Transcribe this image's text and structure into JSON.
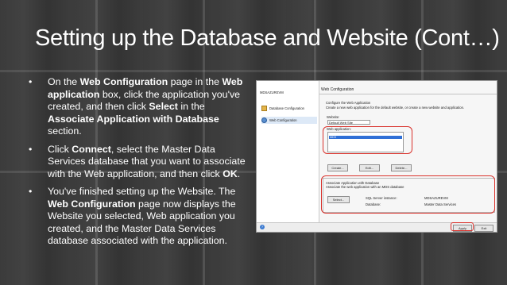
{
  "slide": {
    "title": "Setting up the Database and Website (Cont…)",
    "bullets": [
      {
        "parts": [
          "On the ",
          "Web Configuration",
          " page in the ",
          "Web application",
          " box, click the application you've created, and then click ",
          "Select",
          " in the ",
          "Associate Application with Database",
          " section."
        ]
      },
      {
        "parts": [
          "Click ",
          "Connect",
          ", select the Master Data Services database that you want to associate with the Web application, and then click ",
          "OK",
          "."
        ]
      },
      {
        "parts": [
          "You've finished setting up the Website. The ",
          "Web Configuration",
          " page now displays the Website you selected, Web application you created, and the Master Data Services database associated with the application."
        ]
      }
    ],
    "bullet_glyph": "•"
  },
  "window": {
    "server_name": "MDSAZUREVM",
    "nav": [
      "Database Configuration",
      "Web Configuration"
    ],
    "page_title": "Web Configuration",
    "config_heading": "Configure the Web Application",
    "config_desc": "Create a new web application for the default website, or create a new website and application.",
    "website_label": "Website:",
    "website_value": "Default Web Site",
    "webapp_label": "Web application:",
    "webapp_selected": "MDS",
    "buttons": {
      "create": "Create...",
      "edit": "Edit...",
      "delete": "Delete...",
      "select": "Select...",
      "apply": "Apply",
      "exit": "Exit"
    },
    "assoc_heading": "Associate Application with Database",
    "assoc_desc": "Associate the web application with an MDS database",
    "assoc_labels": [
      "SQL Server instance:",
      "Database:"
    ],
    "assoc_values": [
      "MDSAZUREVM",
      "Master Data Services"
    ],
    "help_glyph": "?"
  },
  "colors": {
    "highlight": "#d9322c",
    "selection": "#2f6fd6"
  }
}
